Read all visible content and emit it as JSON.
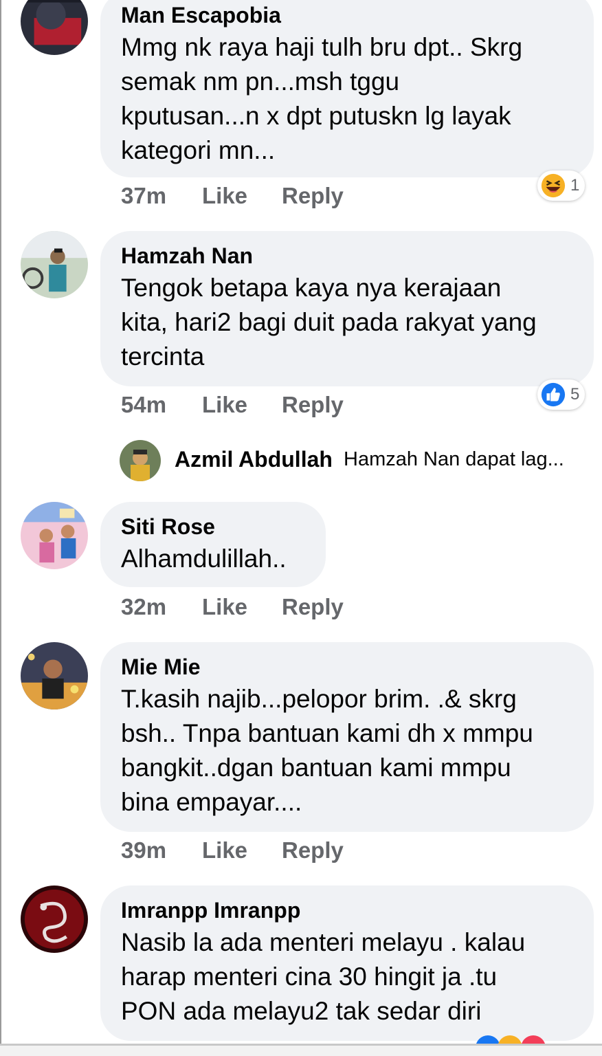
{
  "comments": [
    {
      "name": "Man Escapobia",
      "lines": [
        "Mmg nk raya haji tulh bru dpt.. Skrg",
        "semak nm pn...msh tggu",
        "kputusan...n x dpt putuskn lg layak",
        "kategori mn..."
      ],
      "time": "37m",
      "like": "Like",
      "reply": "Reply",
      "reaction": {
        "icon": "haha-emoji-icon",
        "count": "1"
      }
    },
    {
      "name": "Hamzah Nan",
      "lines": [
        "Tengok betapa kaya nya kerajaan",
        "kita, hari2 bagi duit pada rakyat yang",
        "tercinta"
      ],
      "time": "54m",
      "like": "Like",
      "reply": "Reply",
      "reaction": {
        "icon": "like-thumb-icon",
        "count": "5"
      },
      "nested_reply": {
        "name": "Azmil Abdullah",
        "snippet": "Hamzah Nan dapat lag..."
      }
    },
    {
      "name": "Siti Rose",
      "lines": [
        "Alhamdulillah.."
      ],
      "time": "32m",
      "like": "Like",
      "reply": "Reply"
    },
    {
      "name": "Mie Mie",
      "lines": [
        "T.kasih najib...pelopor brim. .& skrg",
        "bsh.. Tnpa bantuan kami dh x mmpu",
        "bangkit..dgan bantuan kami mmpu",
        "bina empayar...."
      ],
      "time": "39m",
      "like": "Like",
      "reply": "Reply"
    },
    {
      "name": "Imranpp Imranpp",
      "lines": [
        "Nasib la ada menteri melayu . kalau",
        "harap menteri cina 30 hingit ja .tu",
        "PON ada melayu2 tak sedar diri"
      ],
      "reaction": {
        "icon": "mixed-reactions-icon"
      }
    }
  ],
  "colors": {
    "bubble": "#f0f2f5",
    "meta_text": "#65676b",
    "like_blue": "#1877f2",
    "haha_yellow": "#f7b125"
  }
}
